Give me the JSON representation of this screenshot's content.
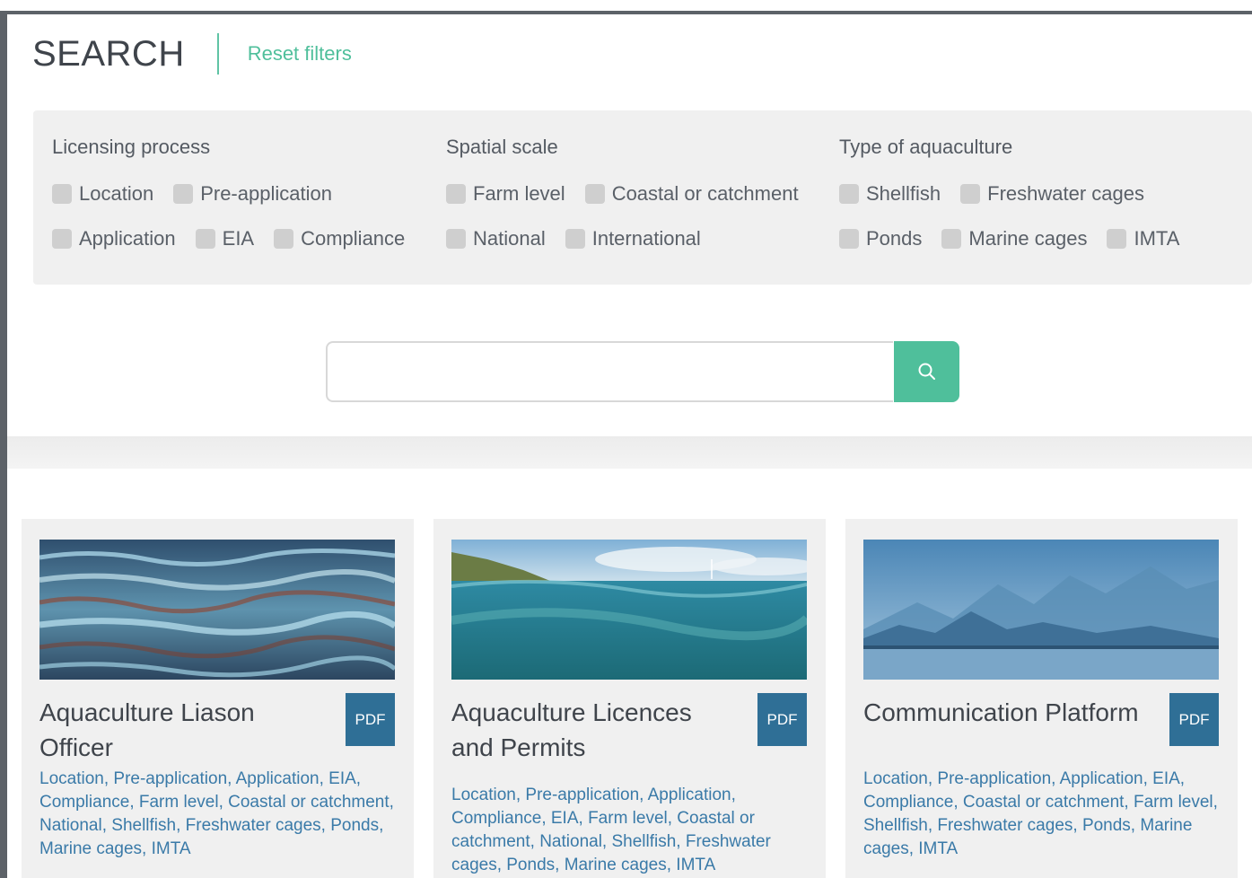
{
  "header": {
    "title": "SEARCH",
    "reset_label": "Reset filters"
  },
  "filters": [
    {
      "title": "Licensing process",
      "rows": [
        [
          "Location",
          "Pre-application"
        ],
        [
          "Application",
          "EIA",
          "Compliance"
        ]
      ]
    },
    {
      "title": "Spatial scale",
      "rows": [
        [
          "Farm level",
          "Coastal or catchment"
        ],
        [
          "National",
          "International"
        ]
      ]
    },
    {
      "title": "Type of aquaculture",
      "rows": [
        [
          "Shellfish",
          "Freshwater cages"
        ],
        [
          "Ponds",
          "Marine cages",
          "IMTA"
        ]
      ]
    }
  ],
  "search": {
    "value": "",
    "placeholder": "",
    "button_icon": "search-icon"
  },
  "cards": [
    {
      "title": "Aquaculture Liason Officer",
      "badge": "PDF",
      "tags": "Location, Pre-application, Application, EIA, Compliance, Farm level, Coastal or catchment, National, Shellfish, Freshwater cages, Ponds, Marine cages, IMTA"
    },
    {
      "title": "Aquaculture Licences and Permits",
      "badge": "PDF",
      "tags": "Location, Pre-application, Application, Compliance, EIA, Farm level, Coastal or catchment, National, Shellfish, Freshwater cages, Ponds, Marine cages, IMTA"
    },
    {
      "title": "Communication Platform",
      "badge": "PDF",
      "tags": "Location, Pre-application, Application, EIA, Compliance, Coastal or catchment, Farm level, Shellfish, Freshwater cages, Ponds, Marine cages, IMTA"
    }
  ],
  "colors": {
    "accent": "#4fbf9b",
    "pdf_badge": "#2f6f96",
    "tag_text": "#3a7aa8",
    "panel": "#f0f0f0"
  }
}
